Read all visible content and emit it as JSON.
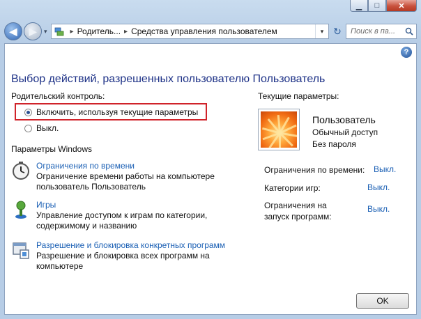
{
  "window": {
    "minimize_glyph": "▁",
    "maximize_glyph": "□",
    "close_glyph": "✕"
  },
  "nav": {
    "back_glyph": "◀",
    "forward_glyph": "▶",
    "dropdown_glyph": "▾",
    "breadcrumb": [
      "Родитель...",
      "Средства управления пользователем"
    ],
    "breadcrumb_separator": "▸",
    "refresh_glyph": "↻",
    "search_placeholder": "Поиск в па..."
  },
  "help_glyph": "?",
  "page_title": "Выбор действий, разрешенных пользователю Пользователь",
  "parental_control": {
    "label": "Родительский контроль:",
    "options": [
      {
        "label": "Включить, используя текущие параметры",
        "checked": true
      },
      {
        "label": "Выкл.",
        "checked": false
      }
    ]
  },
  "windows_settings": {
    "label": "Параметры Windows",
    "tasks": [
      {
        "icon": "clock-icon",
        "title": "Ограничения по времени",
        "description": "Ограничение времени работы на компьютере пользователь Пользователь"
      },
      {
        "icon": "games-icon",
        "title": "Игры",
        "description": "Управление доступом к играм по категории, содержимому и названию"
      },
      {
        "icon": "programs-icon",
        "title": "Разрешение и блокировка конкретных программ",
        "description": "Разрешение и блокировка всех программ на компьютере"
      }
    ]
  },
  "current_settings": {
    "label": "Текущие параметры:",
    "user_name": "Пользователь",
    "account_type": "Обычный доступ",
    "password_status": "Без пароля",
    "items": [
      {
        "label": "Ограничения по времени:",
        "value": "Выкл."
      },
      {
        "label": "Категории игр:",
        "value": "Выкл."
      },
      {
        "label": "Ограничения на запуск программ:",
        "value": "Выкл."
      }
    ]
  },
  "ok_label": "OK",
  "colors": {
    "title": "#1e3287",
    "link": "#1a5fb4",
    "highlight_border": "#d0232a"
  }
}
